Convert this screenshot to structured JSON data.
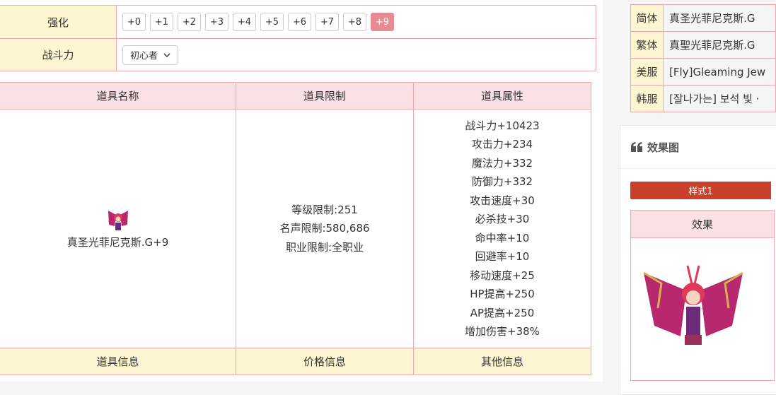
{
  "settings": {
    "enhance_label": "强化",
    "enhance_levels": [
      "+0",
      "+1",
      "+2",
      "+3",
      "+4",
      "+5",
      "+6",
      "+7",
      "+8",
      "+9"
    ],
    "active_level": "+9",
    "combat_label": "战斗力",
    "combat_select": "初心者"
  },
  "item_table": {
    "headers": [
      "道具名称",
      "道具限制",
      "道具属性"
    ],
    "item_name": "真圣光菲尼克斯.G+9",
    "restrictions": [
      "等级限制:251",
      "名声限制:580,686",
      "职业限制:全职业"
    ],
    "attributes": [
      "战斗力+10423",
      "攻击力+234",
      "魔法力+332",
      "防御力+332",
      "攻击速度+30",
      "必杀技+30",
      "命中率+10",
      "回避率+10",
      "移动速度+25",
      "HP提高+250",
      "AP提高+250",
      "增加伤害+38%"
    ],
    "footer_headers": [
      "道具信息",
      "价格信息",
      "其他信息"
    ]
  },
  "names": [
    {
      "label": "简体",
      "value": "真圣光菲尼克斯.G"
    },
    {
      "label": "繁体",
      "value": "真聖光菲尼克斯.G"
    },
    {
      "label": "美服",
      "value": "[Fly]Gleaming Jew"
    },
    {
      "label": "韩服",
      "value": "[잘나가는] 보석 빛 ·"
    }
  ],
  "effect_card": {
    "title": "效果图",
    "style_tab": "样式1",
    "table_header": "效果"
  },
  "colors": {
    "accent": "#c9412b",
    "active_level": "#e88a93",
    "pink_header": "#fbe0e4",
    "yellow_header": "#fdf6d2"
  }
}
